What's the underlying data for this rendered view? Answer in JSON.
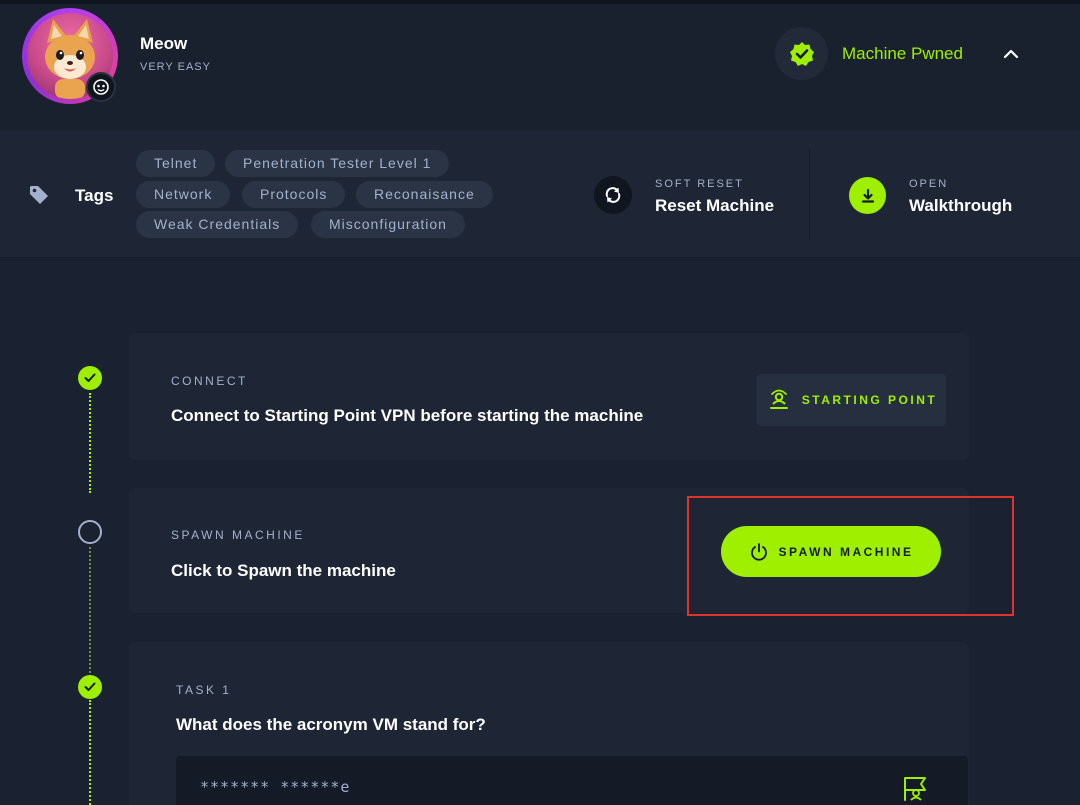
{
  "header": {
    "machine_name": "Meow",
    "difficulty": "VERY EASY",
    "status": "Machine Pwned"
  },
  "tags": {
    "title": "Tags",
    "items": [
      "Telnet",
      "Penetration Tester Level 1",
      "Network",
      "Protocols",
      "Reconaisance",
      "Weak Credentials",
      "Misconfiguration"
    ]
  },
  "actions": {
    "reset": {
      "caption": "SOFT RESET",
      "label": "Reset Machine"
    },
    "walkthrough": {
      "caption": "OPEN",
      "label": "Walkthrough"
    }
  },
  "steps": [
    {
      "caption": "CONNECT",
      "title": "Connect to Starting Point VPN before starting the machine",
      "completed": true,
      "button": "STARTING POINT"
    },
    {
      "caption": "SPAWN MACHINE",
      "title": "Click to Spawn the machine",
      "completed": false,
      "button": "SPAWN MACHINE"
    },
    {
      "caption": "TASK 1",
      "title": "What does the acronym VM stand for?",
      "completed": true,
      "answer_mask": "******* ******e"
    }
  ],
  "colors": {
    "accent": "#9fef00",
    "background": "#1a2130",
    "card": "#1e2635",
    "muted_text": "#a4b1cd",
    "highlight": "#e0332c"
  }
}
